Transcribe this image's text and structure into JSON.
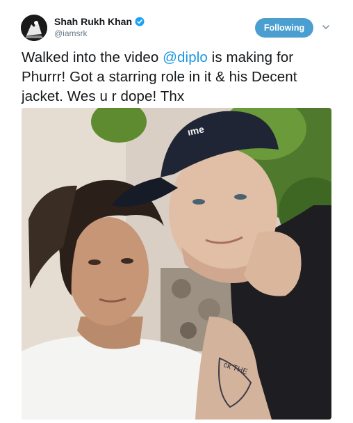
{
  "author": {
    "display_name": "Shah Rukh Khan",
    "handle": "@iamsrk",
    "verified": true,
    "avatar_icon": "profile-avatar"
  },
  "actions": {
    "follow_label": "Following",
    "more_icon": "chevron-down-icon"
  },
  "tweet": {
    "text_before": "Walked into the video ",
    "mention": "@diplo",
    "text_after": " is making for Phurrr! Got a starring role in it & his Decent jacket. Wes u r dope! Thx"
  },
  "media": {
    "cap_text": "ıme",
    "tattoo_text": "ck THE"
  },
  "colors": {
    "accent": "#1b95e0",
    "follow_button": "#4a9fd0",
    "text": "#14171a",
    "secondary_text": "#657786"
  }
}
